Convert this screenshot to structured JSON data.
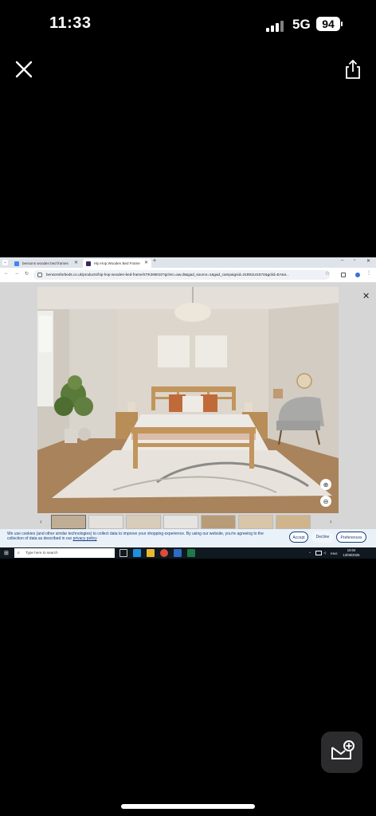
{
  "status_bar": {
    "time": "11:33",
    "network": "5G",
    "battery": "94"
  },
  "browser": {
    "tabs": [
      {
        "label": "bensons wooden bed frames",
        "active": false
      },
      {
        "label": "Hip Hop Wooden Bed Frame",
        "active": true
      }
    ],
    "url": "bensonsforbeds.co.uk/products/hip-hop-wooden-bed-frame/STK268010?gclsrc=aw.ds&gad_source=1&gad_campaignid=21891141574&gclid=EAIaI..."
  },
  "cookie_banner": {
    "text_before_link": "We use cookies (and other similar technologies) to collect data to improve your shopping experience. By using our website, you're agreeing to the collection of data as described in our ",
    "link": "privacy policy",
    "accept": "Accept",
    "decline": "Decline",
    "preferences": "Preferences"
  },
  "taskbar": {
    "search_placeholder": "Type here to search",
    "language": "ENG",
    "time": "10:04",
    "date": "13/06/2025"
  },
  "colors": {
    "accent": "#1a3e7a",
    "cookie_bg": "#e9f1f9",
    "taskbar": "#101820"
  }
}
